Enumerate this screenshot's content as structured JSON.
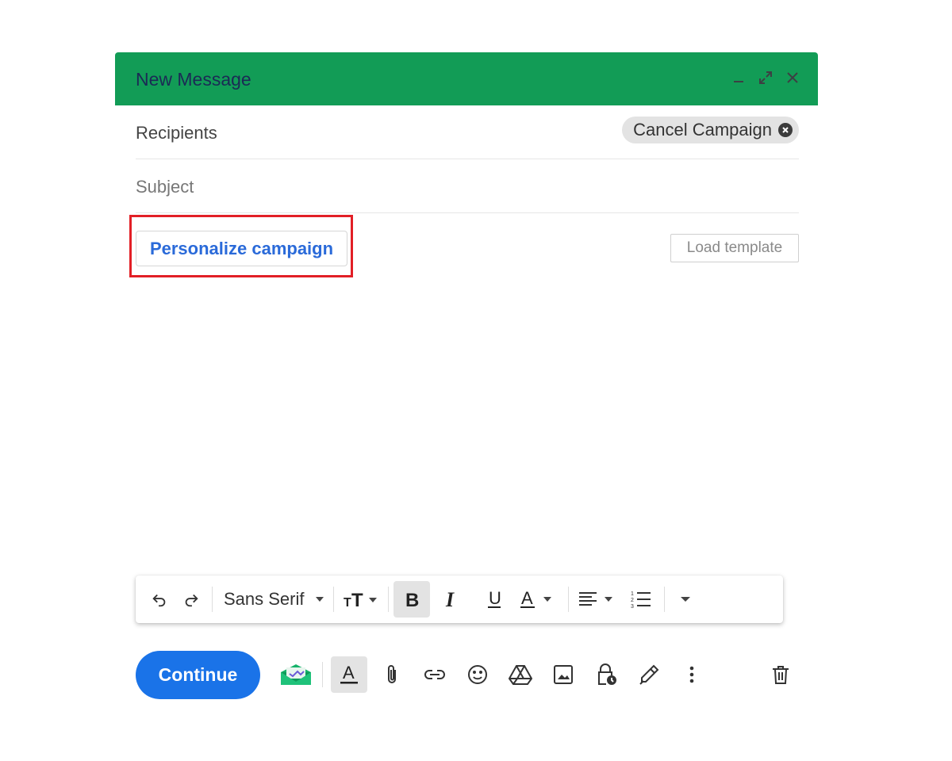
{
  "compose": {
    "title": "New Message",
    "header_color": "#129c56"
  },
  "recipients": {
    "label": "Recipients",
    "chip_label": "Cancel Campaign"
  },
  "subject": {
    "placeholder": "Subject"
  },
  "actions": {
    "personalize_label": "Personalize campaign",
    "load_template_label": "Load template"
  },
  "formatting": {
    "font_family": "Sans Serif",
    "bold_active": true
  },
  "bottom": {
    "continue_label": "Continue",
    "accent": "#1a73e8"
  }
}
